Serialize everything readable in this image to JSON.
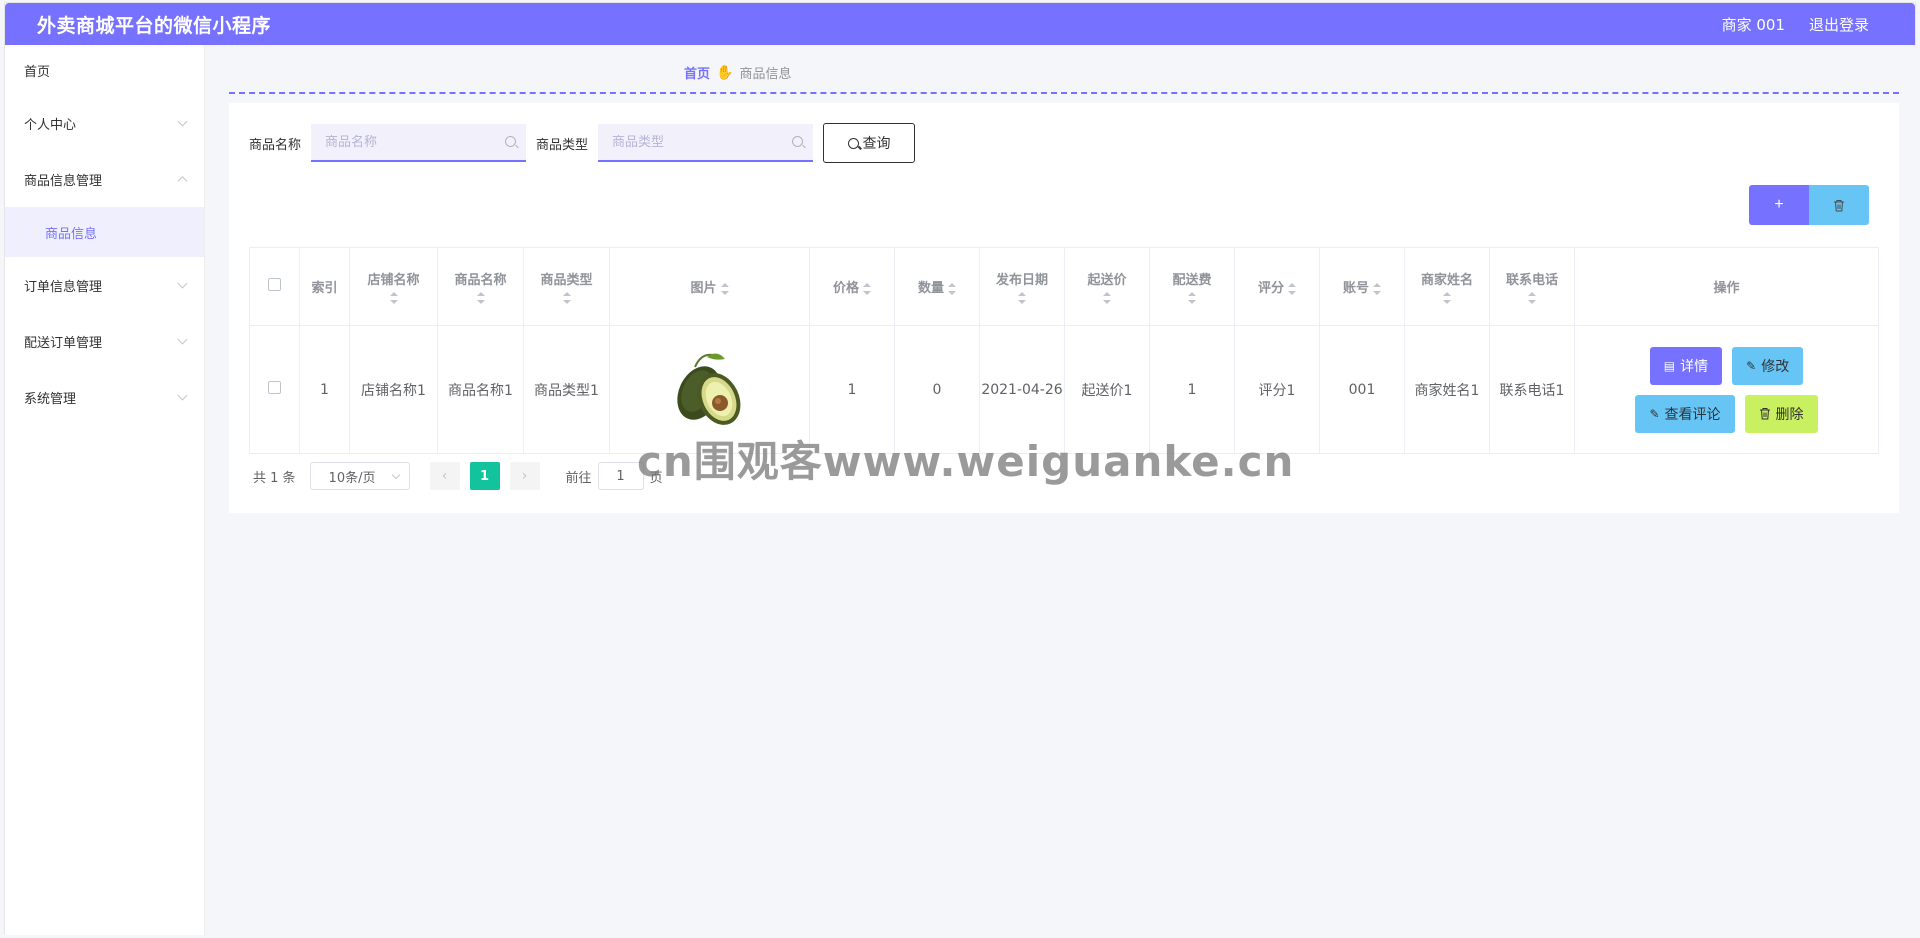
{
  "header": {
    "app_title": "外卖商城平台的微信小程序",
    "user": "商家 001",
    "logout": "退出登录"
  },
  "sidebar": {
    "items": [
      {
        "label": "首页"
      },
      {
        "label": "个人中心"
      },
      {
        "label": "商品信息管理"
      },
      {
        "label": "订单信息管理"
      },
      {
        "label": "配送订单管理"
      },
      {
        "label": "系统管理"
      }
    ],
    "submenu": {
      "label": "商品信息"
    }
  },
  "breadcrumb": {
    "home": "首页",
    "current": "商品信息"
  },
  "search": {
    "name_label": "商品名称",
    "name_placeholder": "商品名称",
    "type_label": "商品类型",
    "type_placeholder": "商品类型",
    "query_button": "查询"
  },
  "toolbar": {
    "add_icon": "plus-icon",
    "delete_icon": "trash-icon"
  },
  "table": {
    "headers": [
      "索引",
      "店铺名称",
      "商品名称",
      "商品类型",
      "图片",
      "价格",
      "数量",
      "发布日期",
      "起送价",
      "配送费",
      "评分",
      "账号",
      "商家姓名",
      "联系电话",
      "操作"
    ],
    "rows": [
      {
        "index": "1",
        "shop": "店铺名称1",
        "name": "商品名称1",
        "type": "商品类型1",
        "image": "avocado-image",
        "price": "1",
        "qty": "0",
        "date": "2021-04-26",
        "min_order": "起送价1",
        "delivery_fee": "1",
        "rating": "评分1",
        "account": "001",
        "merchant": "商家姓名1",
        "phone": "联系电话1"
      }
    ],
    "actions": {
      "detail": "详情",
      "edit": "修改",
      "review": "查看评论",
      "delete": "删除"
    }
  },
  "pagination": {
    "total": "共 1 条",
    "page_size": "10条/页",
    "current_page": "1",
    "goto_label": "前往",
    "goto_value": "1",
    "page_suffix": "页"
  },
  "watermark": "cn围观客www.weiguanke.cn",
  "colors": {
    "primary": "#7672ff",
    "info": "#67c5f6",
    "lime": "#c8f060",
    "pager_active": "#13c39e"
  }
}
